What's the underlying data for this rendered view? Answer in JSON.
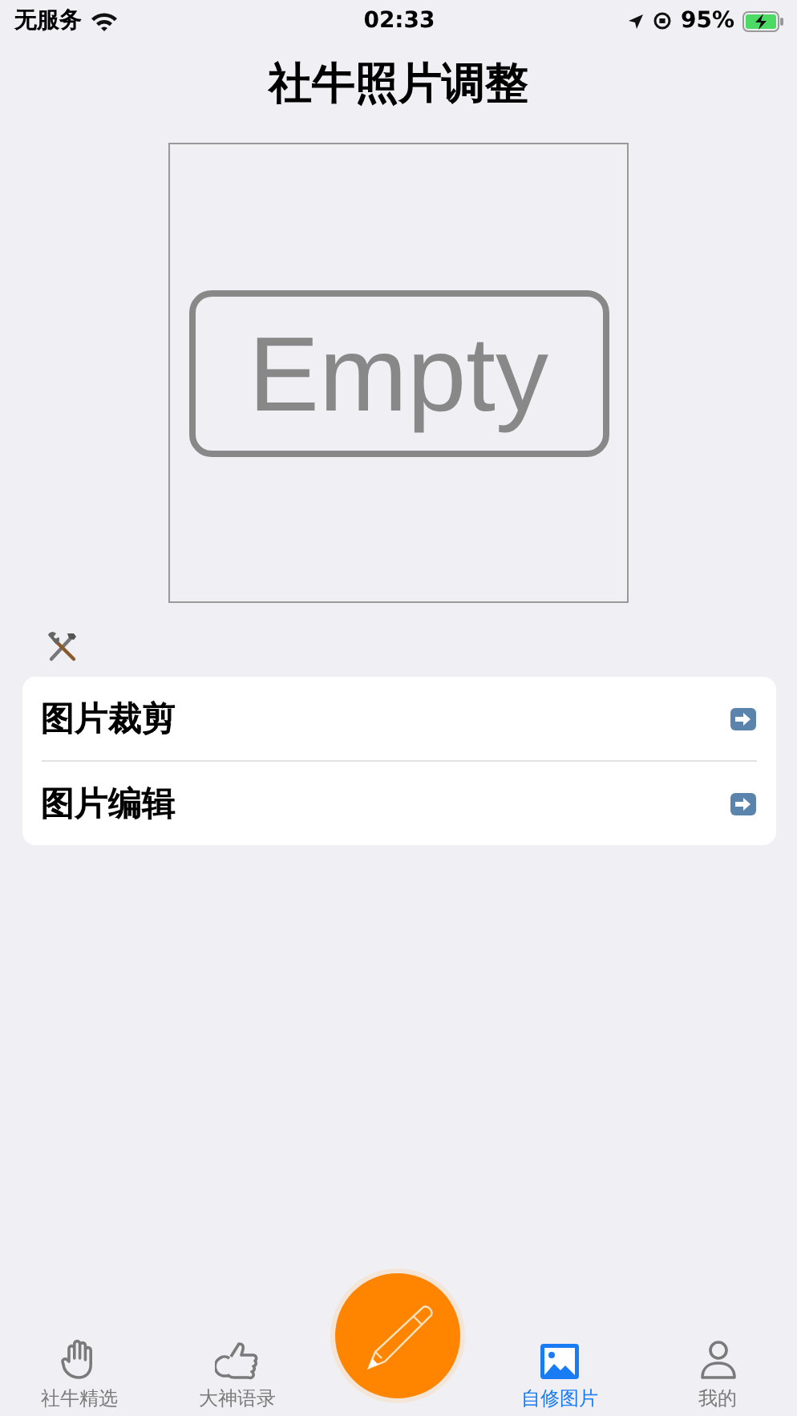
{
  "status_bar": {
    "carrier": "无服务",
    "time": "02:33",
    "battery": "95%"
  },
  "title": "社牛照片调整",
  "preview": {
    "placeholder": "Empty"
  },
  "menu": [
    {
      "label": "图片裁剪"
    },
    {
      "label": "图片编辑"
    }
  ],
  "tabs": [
    {
      "kind": "hand",
      "label": "社牛精选",
      "selected": false
    },
    {
      "kind": "thumb",
      "label": "大神语录",
      "selected": false
    },
    {
      "kind": "pen"
    },
    {
      "kind": "image",
      "label": "自修图片",
      "selected": true
    },
    {
      "kind": "person",
      "label": "我的",
      "selected": false
    }
  ]
}
